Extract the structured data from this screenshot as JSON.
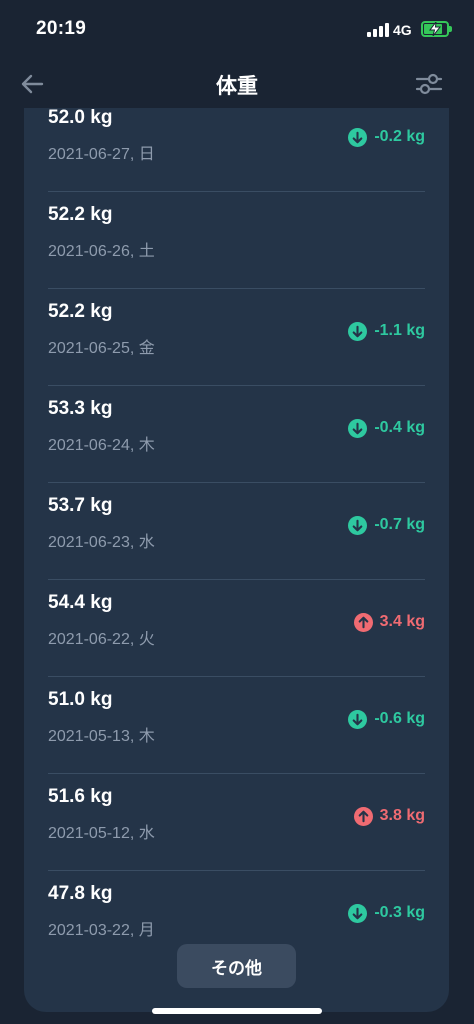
{
  "status_bar": {
    "time": "20:19",
    "network": "4G"
  },
  "header": {
    "title": "体重",
    "back_icon": "arrow-left-icon",
    "filter_icon": "sliders-icon"
  },
  "colors": {
    "background": "#1a2433",
    "card": "#243448",
    "decrease": "#2ec9a0",
    "increase": "#f06b72",
    "date_text": "#8e9bad"
  },
  "entries": [
    {
      "weight": "52.0 kg",
      "date": "2021-06-27, 日",
      "change": "-0.2 kg",
      "direction": "down"
    },
    {
      "weight": "52.2 kg",
      "date": "2021-06-26, 土",
      "change": "",
      "direction": "none"
    },
    {
      "weight": "52.2 kg",
      "date": "2021-06-25, 金",
      "change": "-1.1 kg",
      "direction": "down"
    },
    {
      "weight": "53.3 kg",
      "date": "2021-06-24, 木",
      "change": "-0.4 kg",
      "direction": "down"
    },
    {
      "weight": "53.7 kg",
      "date": "2021-06-23, 水",
      "change": "-0.7 kg",
      "direction": "down"
    },
    {
      "weight": "54.4 kg",
      "date": "2021-06-22, 火",
      "change": "3.4 kg",
      "direction": "up"
    },
    {
      "weight": "51.0 kg",
      "date": "2021-05-13, 木",
      "change": "-0.6 kg",
      "direction": "down"
    },
    {
      "weight": "51.6 kg",
      "date": "2021-05-12, 水",
      "change": "3.8 kg",
      "direction": "up"
    },
    {
      "weight": "47.8 kg",
      "date": "2021-03-22, 月",
      "change": "-0.3 kg",
      "direction": "down"
    }
  ],
  "more_button": {
    "label": "その他"
  }
}
